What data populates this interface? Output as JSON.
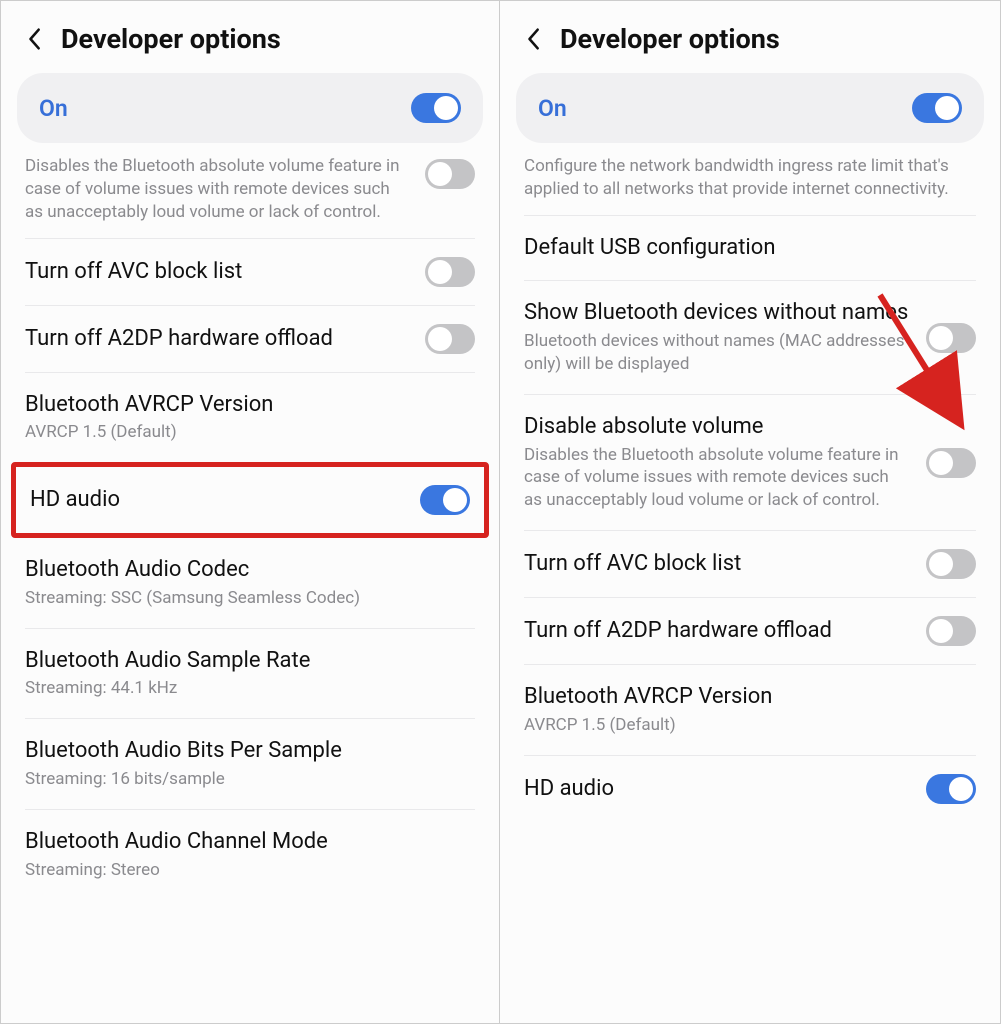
{
  "left": {
    "header": {
      "title": "Developer options"
    },
    "master": {
      "label": "On",
      "on": true
    },
    "partial_top_text": "Disables the Bluetooth absolute volume feature in case of volume issues with remote devices such as unacceptably loud volume or lack of control.",
    "rows": [
      {
        "title": "Turn off AVC block list",
        "sub": "",
        "toggle": "off"
      },
      {
        "title": "Turn off A2DP hardware offload",
        "sub": "",
        "toggle": "off"
      },
      {
        "title": "Bluetooth AVRCP Version",
        "sub": "AVRCP 1.5 (Default)",
        "toggle": null
      },
      {
        "title": "HD audio",
        "sub": "",
        "toggle": "on",
        "highlight": true
      },
      {
        "title": "Bluetooth Audio Codec",
        "sub": "Streaming: SSC (Samsung Seamless Codec)",
        "toggle": null
      },
      {
        "title": "Bluetooth Audio Sample Rate",
        "sub": "Streaming: 44.1 kHz",
        "toggle": null
      },
      {
        "title": "Bluetooth Audio Bits Per Sample",
        "sub": "Streaming: 16 bits/sample",
        "toggle": null
      },
      {
        "title": "Bluetooth Audio Channel Mode",
        "sub": "Streaming: Stereo",
        "toggle": null
      }
    ]
  },
  "right": {
    "header": {
      "title": "Developer options"
    },
    "master": {
      "label": "On",
      "on": true
    },
    "partial_top_text": "Configure the network bandwidth ingress rate limit that's applied to all networks that provide internet connectivity.",
    "rows": [
      {
        "title": "Default USB configuration",
        "sub": "",
        "toggle": null
      },
      {
        "title": "Show Bluetooth devices without names",
        "sub": "Bluetooth devices without names (MAC addresses only) will be displayed",
        "toggle": "off"
      },
      {
        "title": "Disable absolute volume",
        "sub": "Disables the Bluetooth absolute volume feature in case of volume issues with remote devices such as unacceptably loud volume or lack of control.",
        "toggle": "off",
        "arrow": true
      },
      {
        "title": "Turn off AVC block list",
        "sub": "",
        "toggle": "off"
      },
      {
        "title": "Turn off A2DP hardware offload",
        "sub": "",
        "toggle": "off"
      },
      {
        "title": "Bluetooth AVRCP Version",
        "sub": "AVRCP 1.5 (Default)",
        "toggle": null
      },
      {
        "title": "HD audio",
        "sub": "",
        "toggle": "on"
      }
    ]
  }
}
